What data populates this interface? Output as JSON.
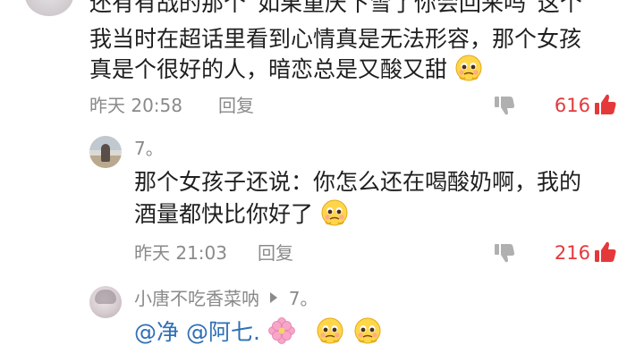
{
  "comments": [
    {
      "line1": "还有有战的那个“如果重庆下雪了你会回来吗”这个",
      "line2": "我当时在超话里看到心情真是无法形容，那个女孩",
      "line3": "真是个很好的人，暗恋总是又酸又甜",
      "emoji": "crying-pleading-face",
      "time": "昨天 20:58",
      "reply_label": "回复",
      "like_count": "616",
      "like_color": "#e5383b"
    },
    {
      "author": "7。",
      "line1": "那个女孩子还说：你怎么还在喝酸奶啊，我的",
      "line2": "酒量都快比你好了",
      "emoji": "crying-pleading-face",
      "time": "昨天 21:03",
      "reply_label": "回复",
      "like_count": "216",
      "like_color": "#e5383b"
    },
    {
      "author": "小唐不吃香菜呐",
      "reply_to": "7。",
      "mention1": "@净",
      "mention2": "@阿七.",
      "emojis": [
        "cherry-blossom",
        "crying-pleading-face",
        "crying-pleading-face"
      ],
      "mention_color": "#2f6fb5"
    }
  ],
  "colors": {
    "like_red": "#e5383b",
    "meta_gray": "#8a8a8a",
    "text": "#1f1f1f"
  }
}
